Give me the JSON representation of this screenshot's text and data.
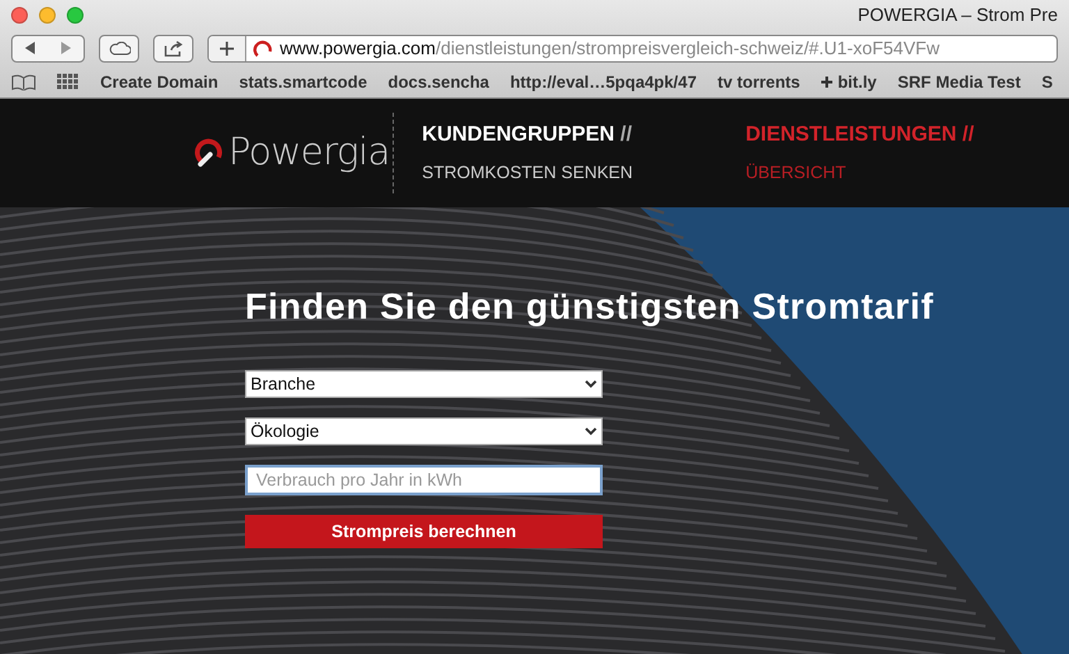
{
  "window": {
    "title": "POWERGIA – Strom Pre"
  },
  "address_bar": {
    "host": "www.powergia.com",
    "path": "/dienstleistungen/strompreisvergleich-schweiz/#.U1-xoF54VFw"
  },
  "bookmarks": [
    {
      "label": "Create Domain",
      "kind": "text"
    },
    {
      "label": "stats.smartcode",
      "kind": "text"
    },
    {
      "label": "docs.sencha",
      "kind": "text"
    },
    {
      "label": "http://eval…5pqa4pk/47",
      "kind": "text"
    },
    {
      "label": "tv torrents",
      "kind": "text"
    },
    {
      "label": "bit.ly",
      "kind": "plus"
    },
    {
      "label": "SRF Media Test",
      "kind": "text"
    },
    {
      "label": "S",
      "kind": "text"
    }
  ],
  "site_nav": {
    "logo": "Powergia",
    "items": [
      {
        "title": "KUNDENGRUPPEN",
        "separator": "//",
        "subtitle": "STROMKOSTEN SENKEN",
        "selected": false
      },
      {
        "title": "DIENSTLEISTUNGEN",
        "separator": "//",
        "subtitle": "ÜBERSICHT",
        "selected": true
      }
    ]
  },
  "hero": {
    "heading": "Finden Sie den günstigsten Stromtarif",
    "fields": [
      {
        "kind": "select",
        "value": "Branche"
      },
      {
        "kind": "select",
        "value": "Ökologie"
      },
      {
        "kind": "input",
        "placeholder": "Verbrauch pro Jahr in kWh"
      }
    ],
    "button": "Strompreis berechnen"
  }
}
